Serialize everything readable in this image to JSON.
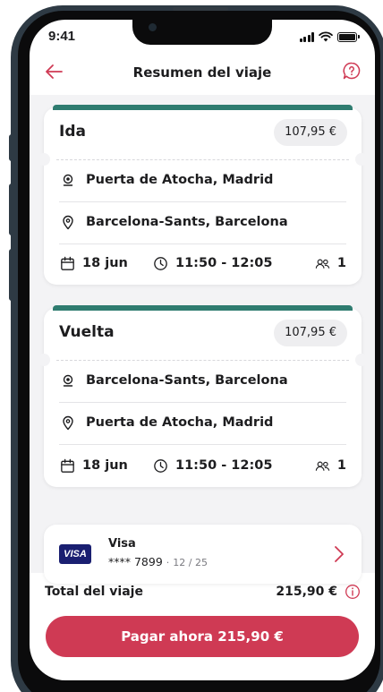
{
  "status_bar": {
    "time": "9:41"
  },
  "header": {
    "title": "Resumen del viaje"
  },
  "trips": [
    {
      "label": "Ida",
      "price": "107,95 €",
      "origin": "Puerta de Atocha, Madrid",
      "destination": "Barcelona-Sants, Barcelona",
      "date": "18 jun",
      "time": "11:50 - 12:05",
      "passengers": "1"
    },
    {
      "label": "Vuelta",
      "price": "107,95 €",
      "origin": "Barcelona-Sants, Barcelona",
      "destination": "Puerta de Atocha, Madrid",
      "date": "18 jun",
      "time": "11:50 - 12:05",
      "passengers": "1"
    }
  ],
  "payment": {
    "logo_text": "VISA",
    "brand": "Visa",
    "number": "**** 7899",
    "separator": "·",
    "expiry": "12 / 25"
  },
  "total": {
    "label": "Total del viaje",
    "amount": "215,90 €"
  },
  "pay_button": {
    "label": "Pagar ahora 215,90 €"
  },
  "icons": {
    "back": "arrow-left-icon",
    "help": "question-bubble-icon",
    "origin": "origin-dot-icon",
    "destination": "location-pin-icon",
    "date": "calendar-icon",
    "time": "clock-icon",
    "passengers": "passengers-icon",
    "next": "chevron-right-icon",
    "info": "info-icon"
  },
  "colors": {
    "accent": "#cf3a54",
    "ticket_bar": "#2f7c70",
    "visa": "#1a1f71",
    "background": "#f3f3f5"
  }
}
